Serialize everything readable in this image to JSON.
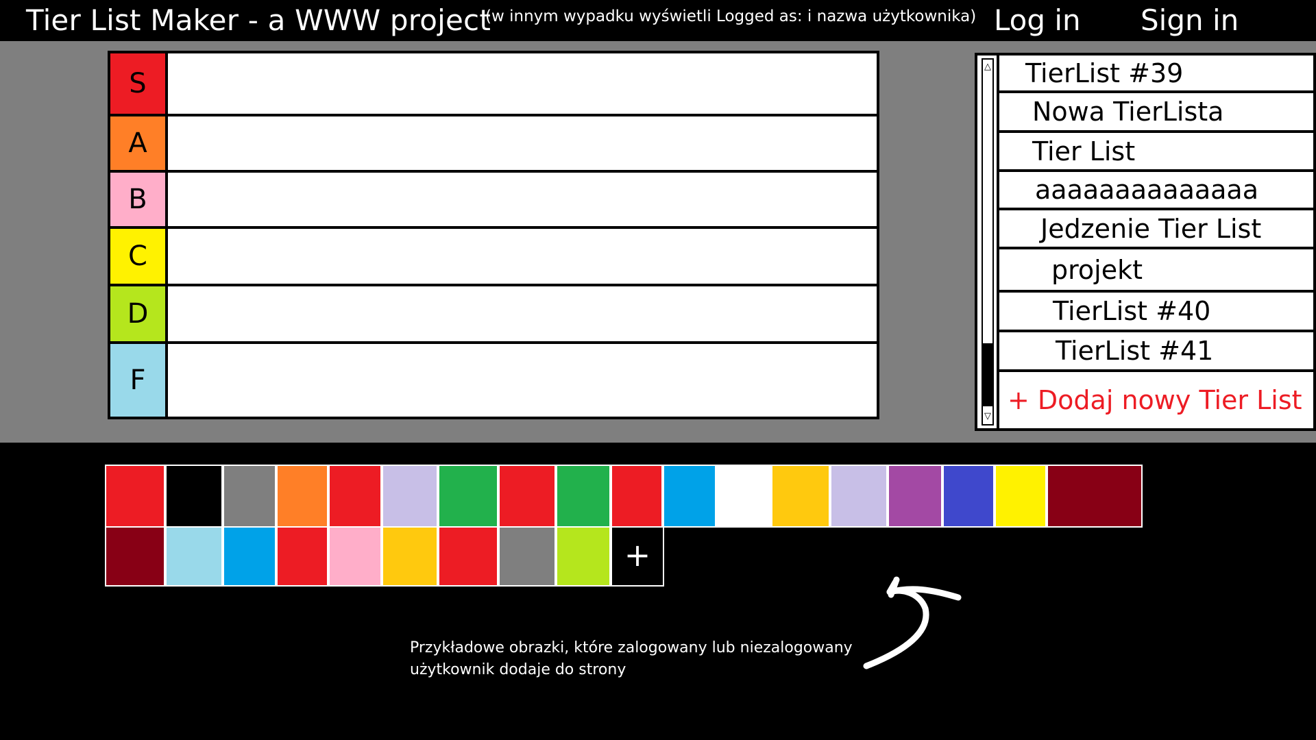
{
  "header": {
    "title": "Tier List Maker - a WWW project",
    "note": "(w innym wypadku wyświetli Logged as: i nazwa użytkownika)",
    "login_label": "Log in",
    "signin_label": "Sign in"
  },
  "tiers": [
    {
      "label": "S",
      "color": "#ed1c24"
    },
    {
      "label": "A",
      "color": "#ff7f27"
    },
    {
      "label": "B",
      "color": "#ffaec9"
    },
    {
      "label": "C",
      "color": "#fff200"
    },
    {
      "label": "D",
      "color": "#b5e61d"
    },
    {
      "label": "F",
      "color": "#99d9ea"
    }
  ],
  "tier_lists": {
    "items": [
      "TierList #39",
      "Nowa TierLista",
      "Tier List",
      "aaaaaaaaaaaaaa",
      "Jedzenie Tier List",
      "projekt",
      "TierList #40",
      "TierList #41"
    ],
    "add_label": "+ Dodaj nowy Tier List",
    "scroll_up_icon": "arrow-up",
    "scroll_down_icon": "arrow-down"
  },
  "images": {
    "row1": [
      "#ed1c24",
      "#000000",
      "#7f7f7f",
      "#ff7f27",
      "#ed1c24",
      "#c8bfe7",
      "#22b14c",
      "#ed1c24",
      "#22b14c",
      "#ed1c24",
      "#00a2e8",
      "#ffffff",
      "#ffc90e",
      "#c8bfe7",
      "#a349a4",
      "#3f48cc",
      "#fff200",
      "#880015"
    ],
    "row2": [
      "#880015",
      "#99d9ea",
      "#00a2e8",
      "#ed1c24",
      "#ffaec9",
      "#ffc90e",
      "#ed1c24",
      "#7f7f7f",
      "#b5e61d"
    ],
    "add_icon": "+"
  },
  "annotation": {
    "text": "Przykładowe obrazki, które zalogowany lub niezalogowany użytkownik dodaje do strony"
  }
}
